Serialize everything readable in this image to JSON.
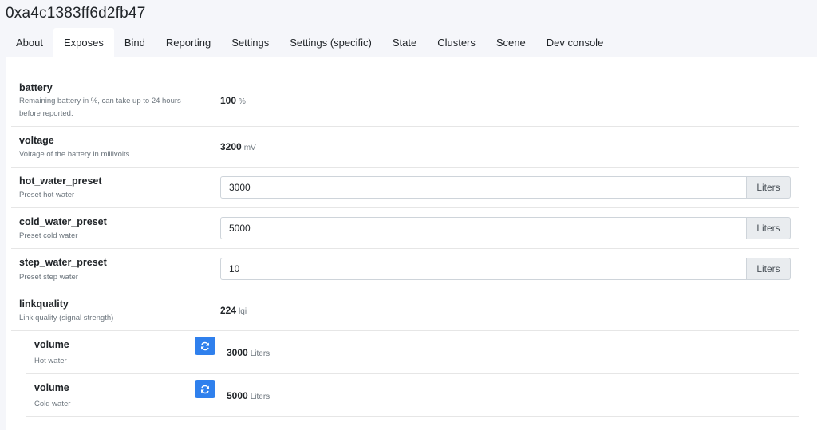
{
  "device_title": "0xa4c1383ff6d2fb47",
  "tabs": [
    {
      "label": "About"
    },
    {
      "label": "Exposes"
    },
    {
      "label": "Bind"
    },
    {
      "label": "Reporting"
    },
    {
      "label": "Settings"
    },
    {
      "label": "Settings (specific)"
    },
    {
      "label": "State"
    },
    {
      "label": "Clusters"
    },
    {
      "label": "Scene"
    },
    {
      "label": "Dev console"
    }
  ],
  "active_tab": "Exposes",
  "exposes": {
    "battery": {
      "name": "battery",
      "desc_line1": "Remaining battery in %, can take up to 24 hours",
      "desc_line2": "before reported.",
      "value": "100",
      "unit": "%"
    },
    "voltage": {
      "name": "voltage",
      "desc": "Voltage of the battery in millivolts",
      "value": "3200",
      "unit": "mV"
    },
    "hot_water_preset": {
      "name": "hot_water_preset",
      "desc": "Preset hot water",
      "value": "3000",
      "unit": "Liters"
    },
    "cold_water_preset": {
      "name": "cold_water_preset",
      "desc": "Preset cold water",
      "value": "5000",
      "unit": "Liters"
    },
    "step_water_preset": {
      "name": "step_water_preset",
      "desc": "Preset step water",
      "value": "10",
      "unit": "Liters"
    },
    "linkquality": {
      "name": "linkquality",
      "desc": "Link quality (signal strength)",
      "value": "224",
      "unit": "lqi"
    },
    "volume_hot": {
      "name": "volume",
      "desc": "Hot water",
      "value": "3000",
      "unit": "Liters"
    },
    "volume_cold": {
      "name": "volume",
      "desc": "Cold water",
      "value": "5000",
      "unit": "Liters"
    }
  },
  "colors": {
    "accent": "#2f80ed",
    "background": "#f5f6fa",
    "panel": "#ffffff"
  },
  "icons": {
    "refresh": "refresh-icon"
  }
}
